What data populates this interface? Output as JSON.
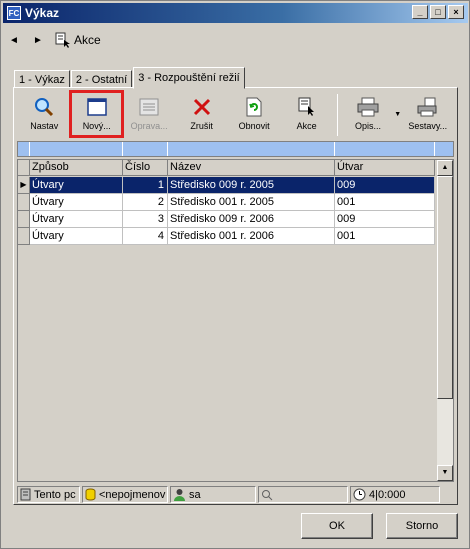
{
  "window": {
    "title": "Výkaz",
    "app_icon": "app-icon",
    "buttons": [
      "_",
      "□",
      "×"
    ]
  },
  "nav": {
    "back": "◄",
    "forward": "►",
    "akce_label": "Akce"
  },
  "tabs": [
    {
      "label": "1 - Výkaz",
      "active": false
    },
    {
      "label": "2 - Ostatní",
      "active": false
    },
    {
      "label": "3 - Rozpouštění režií",
      "active": true
    }
  ],
  "toolbar": {
    "items": [
      {
        "label": "Nastav",
        "icon": "magnifier-icon",
        "enabled": true
      },
      {
        "label": "Nový...",
        "icon": "new-window-icon",
        "enabled": true,
        "highlighted": true
      },
      {
        "label": "Oprava...",
        "icon": "edit-form-icon",
        "enabled": false
      },
      {
        "label": "Zrušit",
        "icon": "delete-x-icon",
        "enabled": true
      },
      {
        "label": "Obnovit",
        "icon": "refresh-icon",
        "enabled": true
      },
      {
        "label": "Akce",
        "icon": "action-cursor-icon",
        "enabled": true
      },
      {
        "label": "Opis...",
        "icon": "printer-icon",
        "enabled": true
      },
      {
        "label": "Sestavy...",
        "icon": "reports-icon",
        "enabled": true
      }
    ],
    "highlight_color": "#e02020"
  },
  "grid": {
    "columns": [
      "Způsob",
      "Číslo",
      "Název",
      "Útvar"
    ],
    "rows": [
      {
        "zpusob": "Útvary",
        "cislo": "1",
        "nazev": "Středisko 009 r. 2005",
        "utvar": "009",
        "selected": true
      },
      {
        "zpusob": "Útvary",
        "cislo": "2",
        "nazev": "Středisko 001 r. 2005",
        "utvar": "001",
        "selected": false
      },
      {
        "zpusob": "Útvary",
        "cislo": "3",
        "nazev": "Středisko 009 r. 2006",
        "utvar": "009",
        "selected": false
      },
      {
        "zpusob": "Útvary",
        "cislo": "4",
        "nazev": "Středisko 001 r. 2006",
        "utvar": "001",
        "selected": false
      }
    ],
    "selected_row_color": "#0a246a",
    "filter_row_color": "#9ec0f0"
  },
  "status": {
    "computer": "Tento pc",
    "database": "<nepojmenov",
    "user": "sa",
    "search": "",
    "time": "4|0:000"
  },
  "buttons": {
    "ok": "OK",
    "cancel": "Storno"
  }
}
